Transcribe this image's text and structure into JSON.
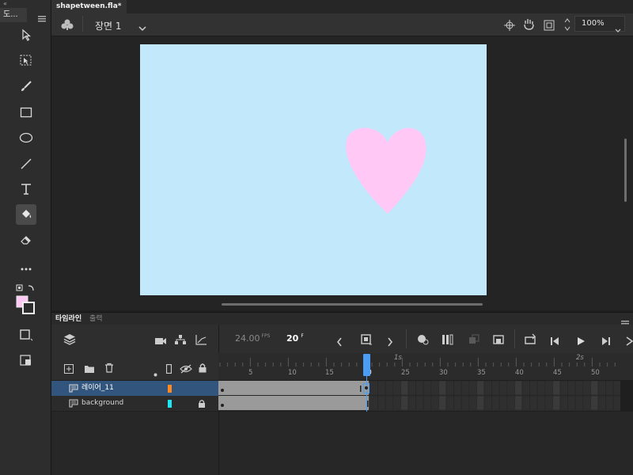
{
  "tools_panel": {
    "title": "도..."
  },
  "document": {
    "tab_title": "shapetween.fla*",
    "close_label": "×"
  },
  "editbar": {
    "scene_label": "장면 1",
    "zoom_value": "100%"
  },
  "stage": {
    "background_color": "#c2e8fc",
    "heart_color": "#ffc8f5"
  },
  "timeline": {
    "tabs": [
      "타임라인",
      "출력"
    ],
    "fps_value": "24.00",
    "fps_unit": "FPS",
    "current_frame": "20",
    "frame_unit": "F",
    "ruler_marks": [
      "5",
      "10",
      "15",
      "20",
      "25",
      "30",
      "35",
      "40",
      "45",
      "50"
    ],
    "time_marks": [
      "1s",
      "2s"
    ],
    "layers": [
      {
        "name": "레이어_11",
        "color": "#ff8a1e",
        "selected": true,
        "locked": false
      },
      {
        "name": "background",
        "color": "#1ee6f5",
        "selected": false,
        "locked": true
      }
    ]
  }
}
